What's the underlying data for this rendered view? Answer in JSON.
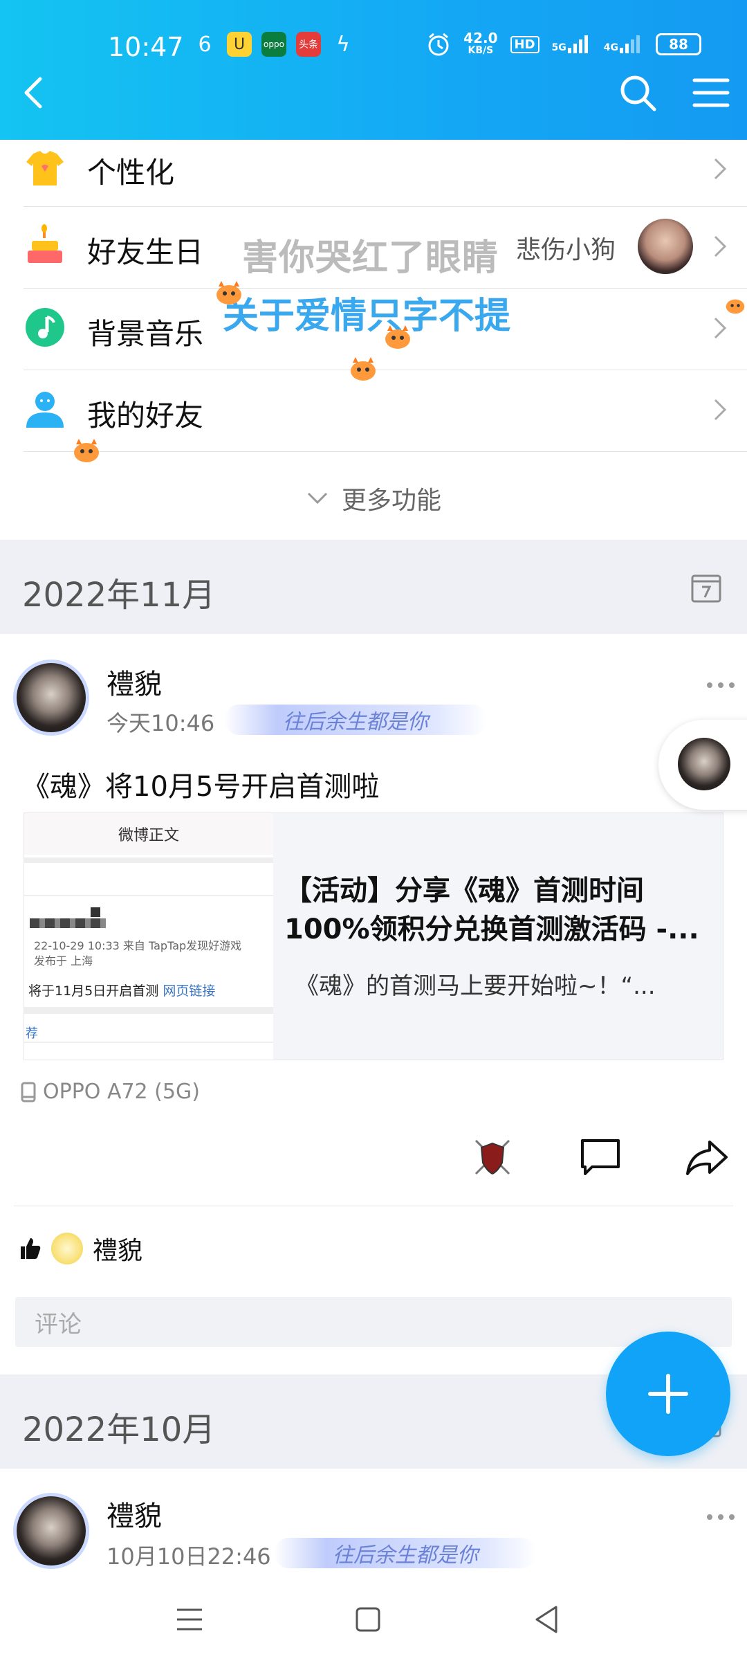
{
  "status": {
    "time": "10:47",
    "apps": [
      "6",
      "U",
      "oppo",
      "头条",
      "ϟ"
    ],
    "net_speed_top": "42.0",
    "net_speed_bottom": "KB/S",
    "hd": "HD",
    "sig1": "5G",
    "sig2": "4G",
    "battery": "88"
  },
  "header": {
    "back_icon": "back-arrow-icon",
    "search_icon": "search-icon",
    "menu_icon": "hamburger-menu-icon"
  },
  "menu": {
    "items": [
      {
        "label": "个性化",
        "icon": "shirt-icon"
      },
      {
        "label": "好友生日",
        "icon": "cake-icon",
        "extra": "悲伤小狗"
      },
      {
        "label": "背景音乐",
        "icon": "music-note-icon"
      },
      {
        "label": "我的好友",
        "icon": "friend-person-icon"
      }
    ],
    "more": "更多功能"
  },
  "overlay": {
    "line1": "害你哭红了眼睛",
    "line2": "关于爱情只字不提"
  },
  "months": [
    "2022年11月",
    "2022年10月"
  ],
  "post1": {
    "author": "禮貌",
    "time": "今天10:46",
    "banner": "往后余生都是你",
    "text": "《魂》将10月5号开启首测啦",
    "share": {
      "thumb_title": "微博正文",
      "thumb_date": "22-10-29 10:33  来自 TapTap发现好游戏",
      "thumb_loc": "发布于 上海",
      "thumb_body": "将于11月5日开启首测 ",
      "thumb_link": "网页链接",
      "thumb_tag": "荐",
      "title": "【活动】分享《魂》首测时间100%领积分兑换首测激活码 -...",
      "desc": "《魂》的首测马上要开始啦~！“..."
    },
    "device": "OPPO A72 (5G)",
    "liker": "禮貌",
    "comment_placeholder": "评论"
  },
  "post2": {
    "author": "禮貌",
    "time": "10月10日22:46",
    "banner": "往后余生都是你"
  },
  "colors": {
    "header": "#14b0f4",
    "accent": "#11a3f7"
  }
}
